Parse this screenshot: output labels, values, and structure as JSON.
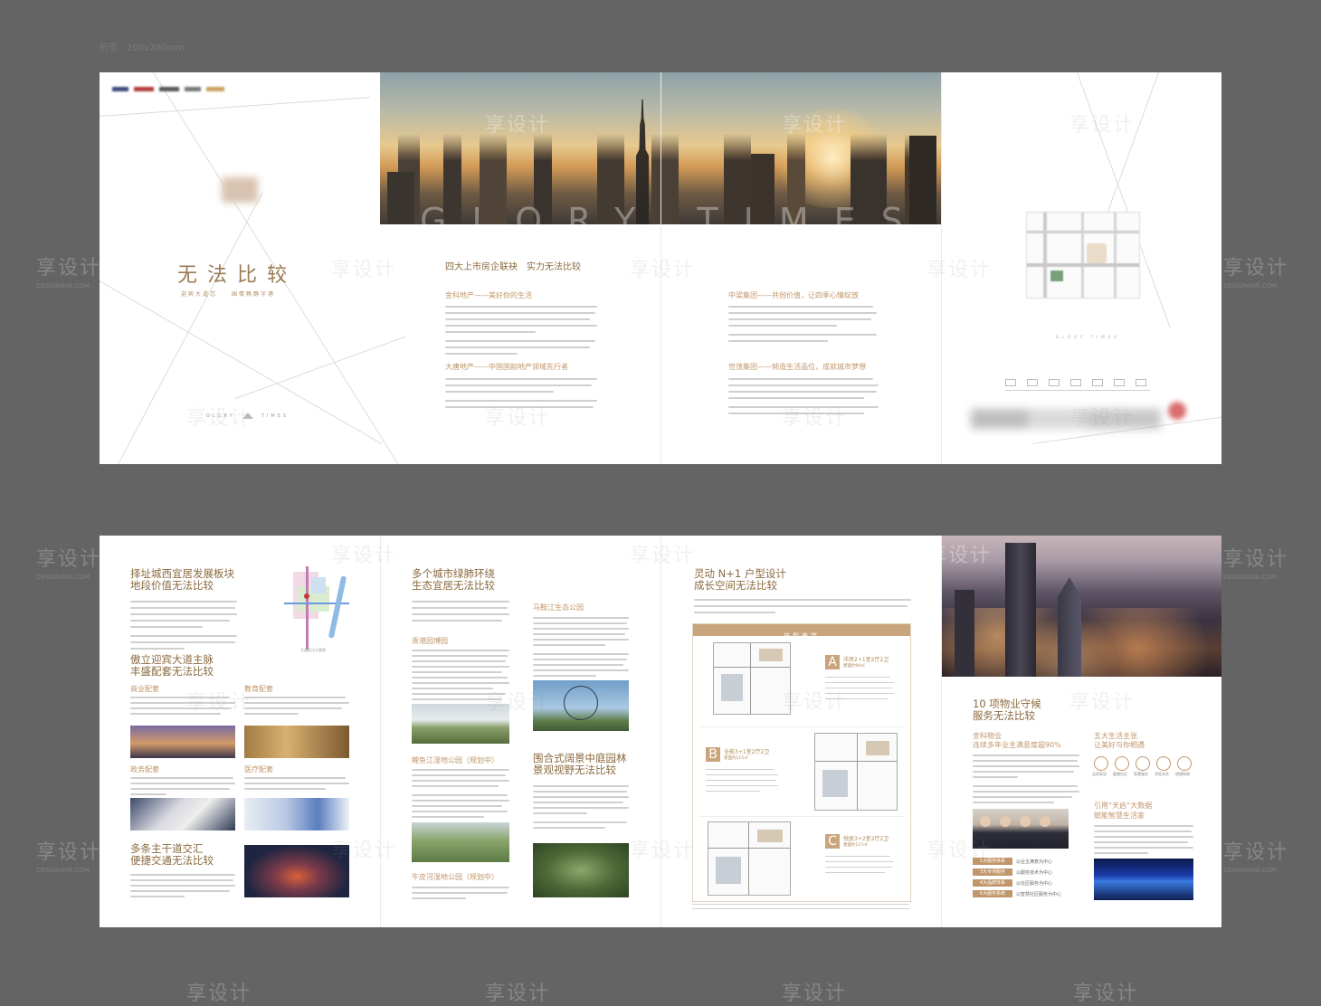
{
  "spec_label": "折页：200x280mm",
  "top_sheet": {
    "cover": {
      "headline": "无 法 比 较",
      "subline": "迎宾大道芯　　国情畅静字港",
      "logo_word_left": "GLORY",
      "logo_word_right": "TIMES"
    },
    "hero_text": "GLORY TIMES",
    "middle_title": "四大上市房企联袂　实力无法比较",
    "developers": [
      {
        "heading": "金科地产——美好你的生活"
      },
      {
        "heading": "大唐地产——中国国韵地产领域先行者"
      },
      {
        "heading": "中梁集团——共创价值，让四季心情绽放"
      },
      {
        "heading": "世茂集团——倾造生活品位，成就城市梦想"
      }
    ],
    "back_logo": "GLORY TIMES"
  },
  "bottom_sheet": {
    "p1": {
      "h1a": "择址城西宜居发展板块",
      "h1b": "地段价值无法比较",
      "map_caption": "交通区位示意图",
      "h2a": "傲立迎宾大道主脉",
      "h2b": "丰盛配套无法比较",
      "sub1": "商业配套",
      "sub2": "教育配套",
      "sub3": "政务配套",
      "sub4": "医疗配套",
      "h3a": "多条主干道交汇",
      "h3b": "便捷交通无法比较"
    },
    "p2": {
      "h1a": "多个城市绿肺环绕",
      "h1b": "生态宜居无法比较",
      "s1": "马鞍江生态公园",
      "s2": "贵港园博园",
      "s3": "鲤鱼江湿地公园（规划中）",
      "s4": "牛皮河湿地公园（规划中）",
      "h2a": "围合式阔景中庭园林",
      "h2b": "景观视野无法比较"
    },
    "p3": {
      "h1a": "灵动 N+1 户型设计",
      "h1b": "成长空间无法比较",
      "band_label": "户型鉴赏",
      "plans": [
        {
          "letter": "A",
          "title": "洋房2+1室2厅2卫",
          "area": "建面约99㎡"
        },
        {
          "letter": "B",
          "title": "全能3+1室2厅2卫",
          "area": "建面约115㎡"
        },
        {
          "letter": "C",
          "title": "悦居3+2室2厅2卫",
          "area": "建面约127㎡"
        }
      ]
    },
    "p4": {
      "h1a": "10 项物业守候",
      "h1b": "服务无法比较",
      "left_sub1": "金科物业",
      "left_sub2": "连续多年业主满意度超90%",
      "right_sub1": "五大生活主张",
      "right_sub2": "让美好与你相遇",
      "icons": [
        "品质家居",
        "健康社区",
        "智慧服务",
        "邻里关系",
        "便捷购物"
      ],
      "big_data_1": "引用“天启”大数据",
      "big_data_2": "赋能智慧生活家",
      "service_pills": [
        {
          "label": "1大服务体系",
          "text": "以业主满意为中心"
        },
        {
          "label": "3大专项服务",
          "text": "以服务技术为中心"
        },
        {
          "label": "4大品牌体系",
          "text": "以社区服务为中心"
        },
        {
          "label": "6大服务系统",
          "text": "以智慧社区服务为中心"
        }
      ]
    }
  },
  "watermark": {
    "text": "享设计",
    "sub": "DESIGN006.COM"
  },
  "colors": {
    "background": "#646464",
    "sheet": "#ffffff",
    "accent": "#b08a5a",
    "heading": "#8a6a3f"
  }
}
